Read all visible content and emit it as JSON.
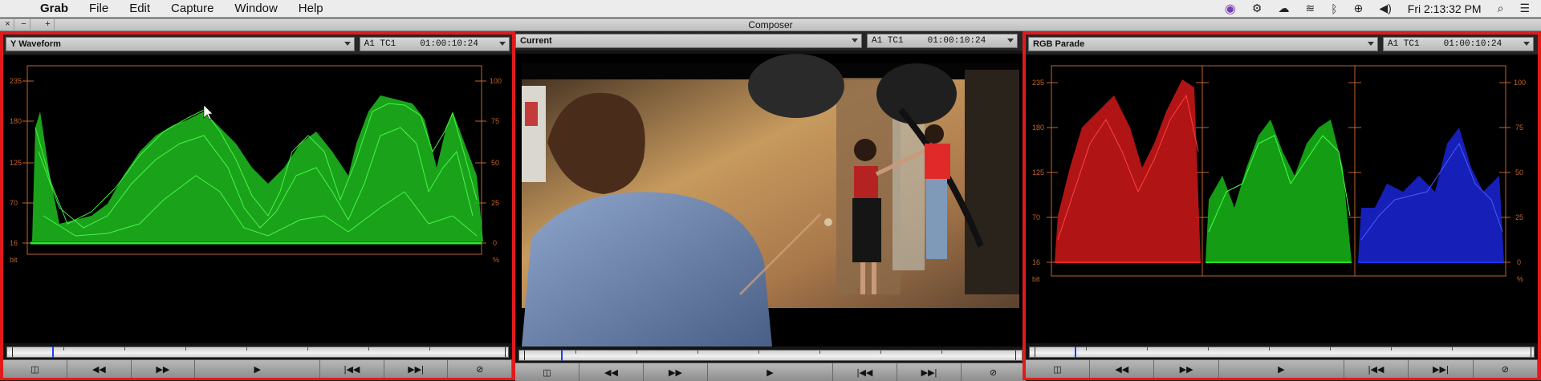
{
  "menubar": {
    "app": "Grab",
    "menus": [
      "File",
      "Edit",
      "Capture",
      "Window",
      "Help"
    ],
    "clock": "Fri 2:13:32 PM"
  },
  "window": {
    "title": "Composer",
    "controls": [
      "×",
      "−",
      "+"
    ]
  },
  "panels": {
    "left": {
      "mode": "Y Waveform",
      "track": "A1 TC1",
      "timecode": "01:00:10:24"
    },
    "center": {
      "mode": "Current",
      "track": "A1 TC1",
      "timecode": "01:00:10:24"
    },
    "right": {
      "mode": "RGB Parade",
      "track": "A1 TC1",
      "timecode": "01:00:10:24"
    }
  },
  "scope_labels": {
    "left_scale": [
      "235",
      "180",
      "125",
      "70",
      "16",
      "bit"
    ],
    "right_scale": [
      "100",
      "75",
      "50",
      "25",
      "0",
      "%"
    ]
  },
  "colors": {
    "highlight": "#e11b1b",
    "graticule": "#c0642c",
    "waveform": "#2ee82e",
    "red": "#ff2020",
    "green": "#22e022",
    "blue": "#2030ff"
  },
  "toolbar_icons": [
    "split-icon",
    "rewind-icon",
    "fast-forward-icon",
    "play-icon",
    "step-back-icon",
    "step-forward-icon",
    "no-entry-icon"
  ]
}
